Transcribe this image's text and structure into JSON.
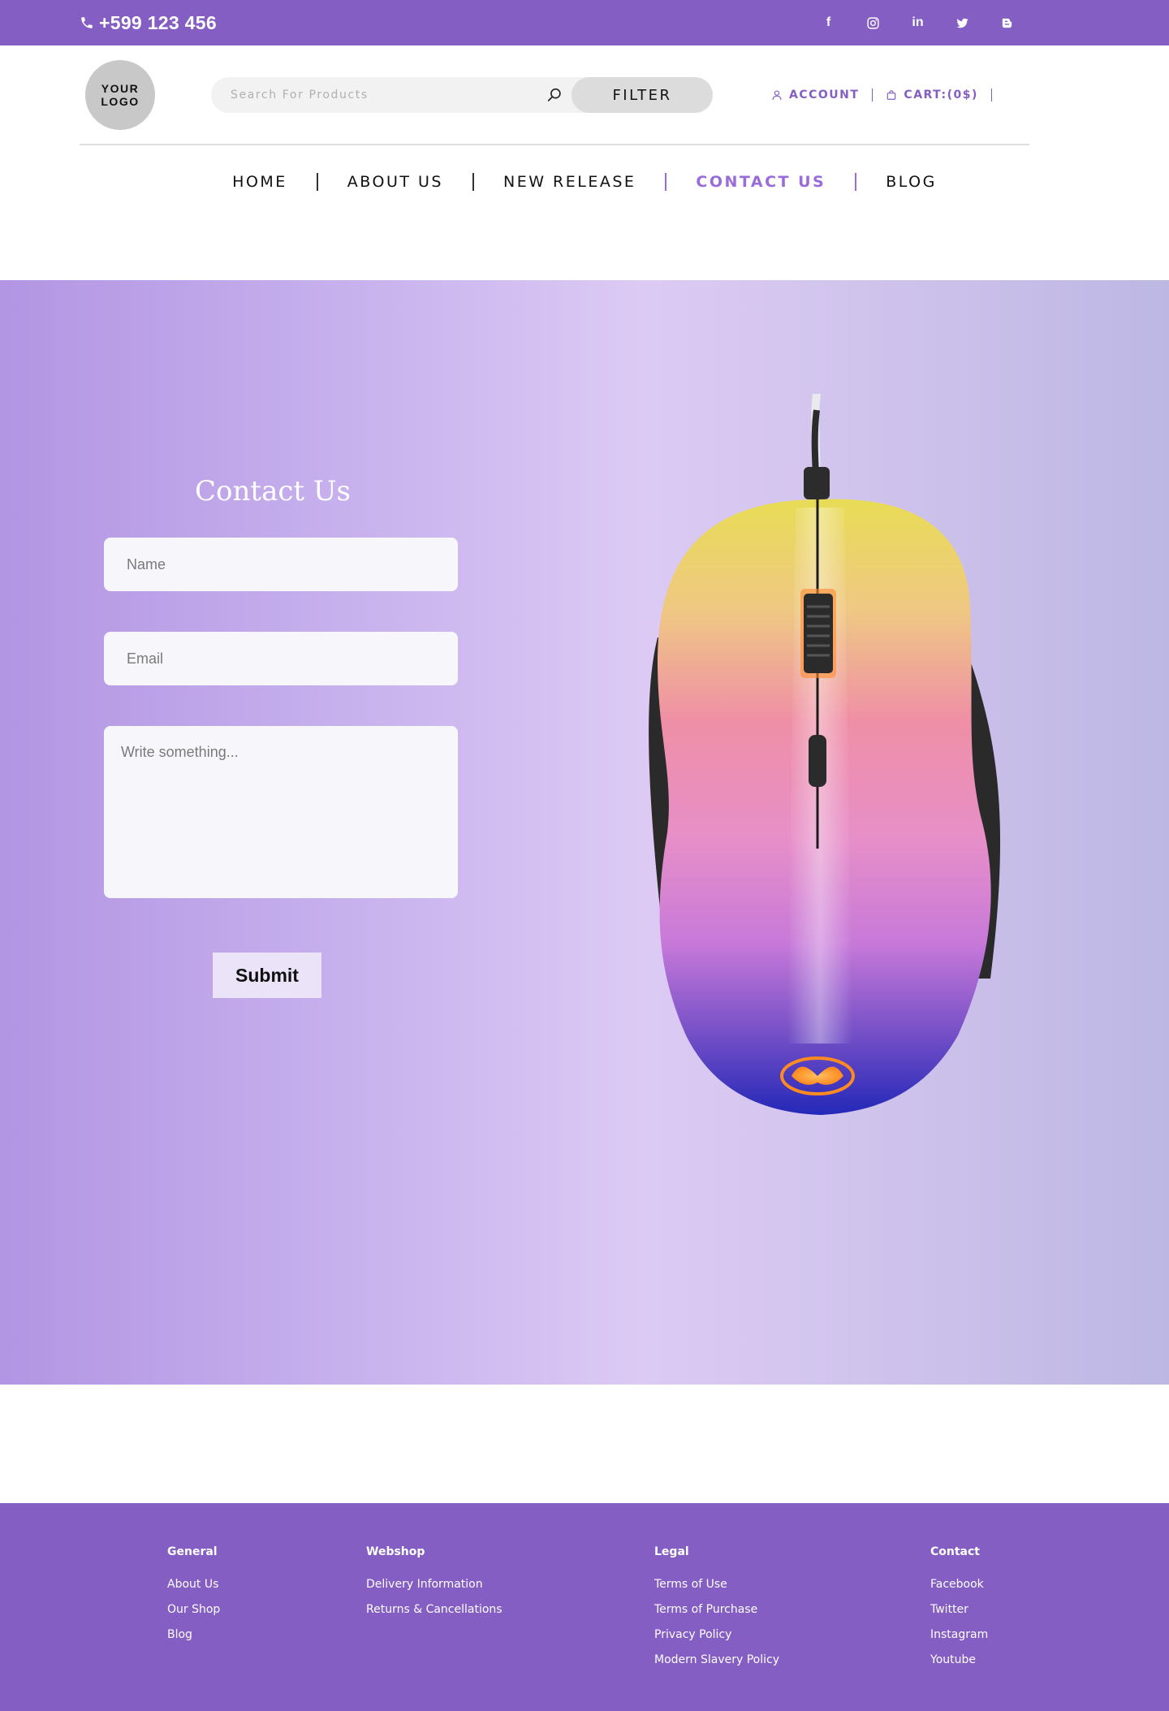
{
  "topbar": {
    "phone": "+599 123 456",
    "socials": [
      {
        "icon": "facebook-icon",
        "label": "f"
      },
      {
        "icon": "instagram-icon",
        "label": ""
      },
      {
        "icon": "linkedin-icon",
        "label": "in"
      },
      {
        "icon": "twitter-icon",
        "label": ""
      },
      {
        "icon": "blogger-icon",
        "label": ""
      }
    ]
  },
  "header": {
    "logo_line1": "YOUR",
    "logo_line2": "LOGO",
    "search_placeholder": "Search For Products",
    "filter_label": "FILTER",
    "account_label": "ACCOUNT",
    "cart_label": "CART:(0$)"
  },
  "nav": {
    "items": [
      {
        "label": "HOME",
        "active": false
      },
      {
        "label": "ABOUT US",
        "active": false
      },
      {
        "label": "NEW RELEASE",
        "active": false
      },
      {
        "label": "CONTACT US",
        "active": true
      },
      {
        "label": "BLOG",
        "active": false
      }
    ]
  },
  "contact": {
    "title": "Contact Us",
    "name_placeholder": "Name",
    "email_placeholder": "Email",
    "message_placeholder": "Write something...",
    "submit_label": "Submit"
  },
  "footer": {
    "columns": [
      {
        "heading": "General",
        "links": [
          "About Us",
          "Our Shop",
          "Blog"
        ]
      },
      {
        "heading": "Webshop",
        "links": [
          "Delivery Information",
          "Returns & Cancellations"
        ]
      },
      {
        "heading": "Legal",
        "links": [
          "Terms of Use",
          "Terms of Purchase",
          "Privacy Policy",
          "Modern Slavery Policy"
        ]
      },
      {
        "heading": "Contact",
        "links": [
          "Facebook",
          "Twitter",
          "Instagram",
          "Youtube"
        ]
      }
    ]
  },
  "colors": {
    "brand": "#845ec2",
    "accent": "#9a6cdb"
  }
}
